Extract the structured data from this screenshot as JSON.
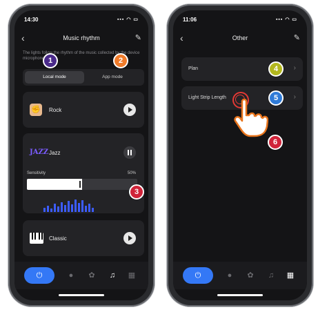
{
  "colors": {
    "power_button": "#3478f6",
    "badge_purple": "#4a2a8a",
    "badge_orange": "#f07b2a",
    "badge_red": "#d0243a",
    "badge_olive": "#b3b81e",
    "badge_blue": "#2f7bd8",
    "jazz_logo": "#7b5cff",
    "equalizer": "#3c5cff"
  },
  "left_screen": {
    "status_time": "14:30",
    "status_icons": "▪▪▪ ◠ ▭",
    "nav_title": "Music rhythm",
    "back_icon": "‹",
    "edit_icon": "✎",
    "description": "The lights follow the rhythm of the music collected by the device microphone",
    "mode_tabs": [
      "Local mode",
      "App mode"
    ],
    "cards": {
      "rock": {
        "title": "Rock",
        "icon": "rock-hand-icon"
      },
      "jazz": {
        "title": "Jazz",
        "logo": "JAZZ",
        "sensitivity_label": "Sensitivity",
        "sensitivity_value": "50%",
        "sensitivity_level": 0.5
      },
      "classic": {
        "title": "Classic",
        "icon": "piano-icon"
      }
    },
    "badges": [
      "1",
      "2",
      "3"
    ],
    "bottom_nav": [
      "power-icon",
      "bulb-icon",
      "palette-icon",
      "music-note-icon",
      "grid-icon"
    ]
  },
  "right_screen": {
    "status_time": "11:06",
    "status_icons": "▪▪▪ ◠ ▭",
    "nav_title": "Other",
    "back_icon": "‹",
    "edit_icon": "✎",
    "rows": [
      {
        "label": "Plan",
        "chevron": "›"
      },
      {
        "label": "Light Strip Length",
        "chevron": "›"
      }
    ],
    "badges": [
      "4",
      "5",
      "6"
    ],
    "bottom_nav": [
      "power-icon",
      "bulb-icon",
      "palette-icon",
      "music-note-icon",
      "grid-icon"
    ]
  }
}
